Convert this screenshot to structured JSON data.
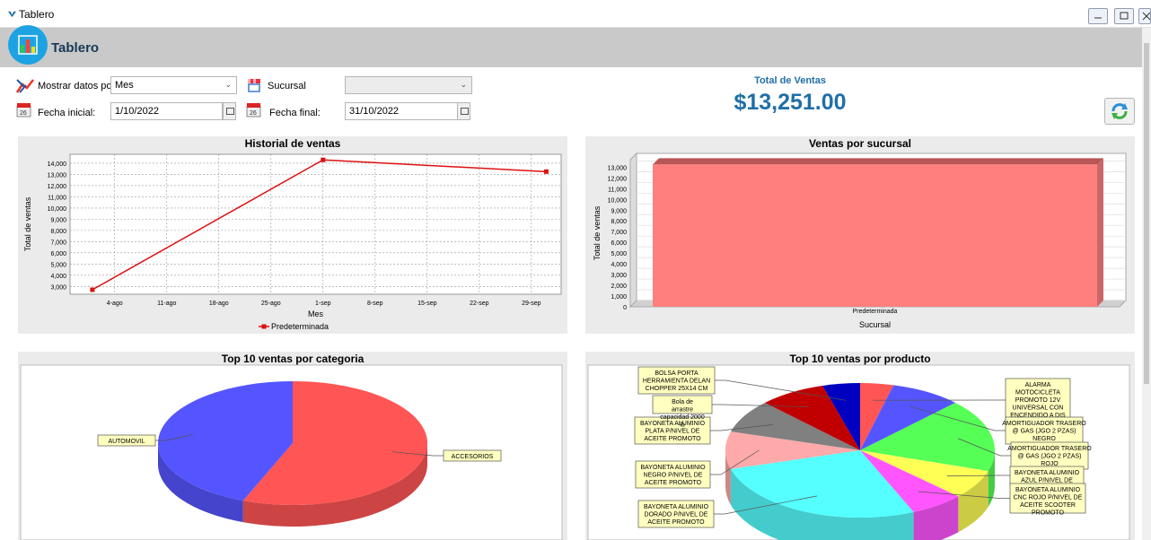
{
  "window": {
    "title": "Tablero"
  },
  "header": {
    "title": "Tablero"
  },
  "filters": {
    "mostrar_label": "Mostrar datos por:",
    "mostrar_value": "Mes",
    "sucursal_label": "Sucursal",
    "sucursal_value": "",
    "fecha_inicial_label": "Fecha inicial:",
    "fecha_inicial_value": "1/10/2022",
    "fecha_final_label": "Fecha final:",
    "fecha_final_value": "31/10/2022"
  },
  "total": {
    "title": "Total de Ventas",
    "value": "$13,251.00"
  },
  "colors": {
    "accent": "#1f6fa8",
    "line": "#dd1111",
    "bar": "#ff7f7f",
    "header_bg": "#c9c9c9",
    "logo": "#1ea3e2"
  },
  "chart_data": [
    {
      "type": "line",
      "title": "Historial de ventas",
      "xlabel": "Mes",
      "ylabel": "Total de ventas",
      "categories": [
        "4-ago",
        "11-ago",
        "18-ago",
        "25-ago",
        "1-sep",
        "8-sep",
        "15-sep",
        "22-sep",
        "29-sep"
      ],
      "yticks": [
        3000,
        4000,
        5000,
        6000,
        7000,
        8000,
        9000,
        10000,
        11000,
        12000,
        13000,
        14000
      ],
      "ytick_labels": [
        "3,000",
        "4,000",
        "5,000",
        "6,000",
        "7,000",
        "8,000",
        "9,000",
        "10,000",
        "11,000",
        "12,000",
        "13,000",
        "14,000"
      ],
      "ylim": [
        2300,
        14800
      ],
      "series": [
        {
          "name": "Predeterminada",
          "points": [
            [
              "2022-08-01",
              2700
            ],
            [
              "2022-09-01",
              14300
            ],
            [
              "2022-10-01",
              13251
            ]
          ]
        }
      ],
      "grid": true,
      "legend": "bottom"
    },
    {
      "type": "bar",
      "title": "Ventas por sucursal",
      "xlabel": "Sucursal",
      "ylabel": "Total de ventas",
      "categories": [
        "Predeterminada"
      ],
      "values": [
        13251
      ],
      "yticks": [
        0,
        1000,
        2000,
        3000,
        4000,
        5000,
        6000,
        7000,
        8000,
        9000,
        10000,
        11000,
        12000,
        13000
      ],
      "ytick_labels": [
        "0",
        "1,000",
        "2,000",
        "3,000",
        "4,000",
        "5,000",
        "6,000",
        "7,000",
        "8,000",
        "9,000",
        "10,000",
        "11,000",
        "12,000",
        "13,000"
      ],
      "ylim": [
        0,
        13700
      ],
      "grid": true
    },
    {
      "type": "pie",
      "title": "Top 10 ventas por categoria",
      "labels": [
        "ACCESORIOS",
        "AUTOMOVIL"
      ],
      "fractions": [
        0.56,
        0.44
      ],
      "colors": [
        "#ff5555",
        "#5555ff"
      ]
    },
    {
      "type": "pie",
      "title": "Top 10 ventas por producto",
      "labels": [
        "ALARMA MOTOCICLETA PROMOTO 12V UNIVERSAL CON ENCENDIDO A DIS",
        "AMORTIGUADOR TRASERO @ GAS (JGO 2 PZAS) NEGRO",
        "AMORTIGUADOR TRASERO @ GAS (JGO 2 PZAS) ROJO",
        "BAYONETA ALUMINIO AZUL P/NIVEL DE",
        "BAYONETA ALUMINIO CNC ROJO P/NIVEL DE ACEITE SCOOTER PROMOTO",
        "BAYONETA ALUMINIO DORADO P/NIVEL DE ACEITE PROMOTO",
        "BAYONETA ALUMINIO NEGRO P/NIVEL DE ACEITE PROMOTO",
        "BAYONETA ALUMINIO PLATA P/NIVEL DE ACEITE PROMOTO",
        "Bola de arrastre capacidad 2000 lb",
        "BOLSA PORTA HERRAMIENTA DELAN CHOPPER 25X14 CM"
      ],
      "fractions": [
        0.04,
        0.085,
        0.175,
        0.07,
        0.065,
        0.27,
        0.09,
        0.08,
        0.08,
        0.045
      ],
      "colors": [
        "#ff5555",
        "#5555ff",
        "#55ff55",
        "#ffff55",
        "#ff55ff",
        "#55ffff",
        "#ffaaaa",
        "#808080",
        "#c00000",
        "#0000c0"
      ]
    }
  ]
}
